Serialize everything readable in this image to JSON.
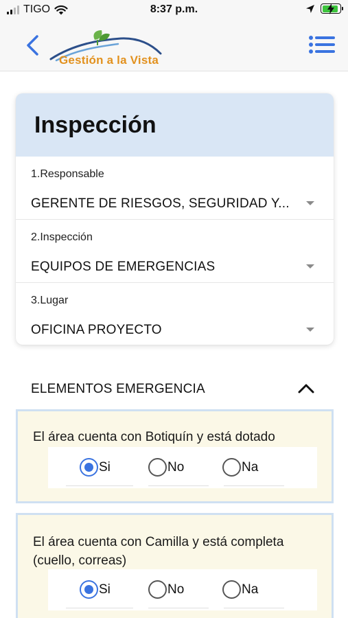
{
  "status_bar": {
    "carrier": "TIGO",
    "time": "8:37 p.m."
  },
  "header": {
    "back_icon": "chevron-left-icon",
    "logo_text": "Gestión a la Vista",
    "menu_icon": "list-menu-icon",
    "accent_color": "#3a73e0"
  },
  "card": {
    "title": "Inspección",
    "header_color": "#d9e6f5",
    "fields": [
      {
        "label": "1.Responsable",
        "value": "GERENTE DE RIESGOS, SEGURIDAD Y..."
      },
      {
        "label": "2.Inspección",
        "value": "EQUIPOS DE EMERGENCIAS"
      },
      {
        "label": "3.Lugar",
        "value": "OFICINA PROYECTO"
      }
    ]
  },
  "section": {
    "title": "ELEMENTOS EMERGENCIA",
    "icon": "chevron-up-icon"
  },
  "questions": [
    {
      "text": "El área cuenta con Botiquín y está dotado",
      "options": [
        "Si",
        "No",
        "Na"
      ],
      "selected": "Si"
    },
    {
      "text": "El área cuenta con Camilla y está completa (cuello, correas)",
      "options": [
        "Si",
        "No",
        "Na"
      ],
      "selected": "Si"
    }
  ]
}
